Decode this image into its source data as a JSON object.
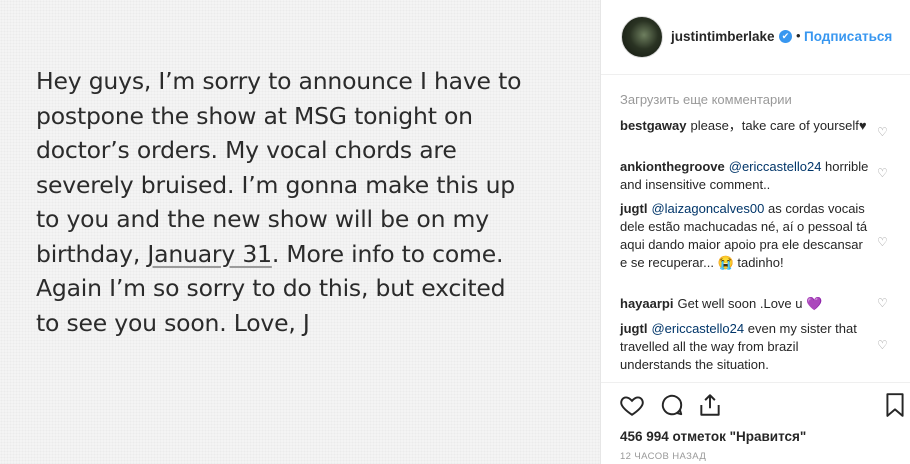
{
  "post": {
    "note_lines": [
      "Hey guys, I’m sorry to announce I have to",
      "postpone the show at MSG tonight on",
      "doctor’s orders. My vocal chords are",
      "severely bruised. I’m gonna make this up",
      "to you and the new show will be on my",
      "birthday, ",
      "January 31",
      ". More info to come.",
      "Again I’m so sorry to do this, but excited",
      "to see you soon. Love, J"
    ]
  },
  "header": {
    "username": "justintimberlake",
    "verified_icon": "✔",
    "dot": "•",
    "follow_label": "Подписаться"
  },
  "load_more_label": "Загрузить еще комментарии",
  "comments": [
    {
      "user": "bestgaway",
      "text": "please，take care of yourself♥"
    },
    {
      "user": "ankionthegroove",
      "mention": "@ericcastello24",
      "text": " horrible and insensitive comment.."
    },
    {
      "user": "jugtl",
      "mention": "@laizagoncalves00",
      "text": " as cordas vocais dele estão machucadas né, aí o pessoal tá aqui dando maior apoio pra ele descansar e se recuperar... 😭 tadinho!"
    },
    {
      "user": "hayaarpi",
      "text": "Get well soon .Love u 💜"
    },
    {
      "user": "jugtl",
      "mention": "@ericcastello24",
      "text": " even my sister that travelled all the way from brazil understands the situation."
    }
  ],
  "actions": {
    "like_icon": "heart-icon",
    "comment_icon": "comment-icon",
    "share_icon": "share-icon",
    "save_icon": "bookmark-icon"
  },
  "likes_text": "456 994 отметок \"Нравится\"",
  "time_text": "12 ЧАСОВ НАЗАД",
  "colors": {
    "accent": "#3897f0",
    "text": "#262626",
    "muted": "#999999"
  }
}
